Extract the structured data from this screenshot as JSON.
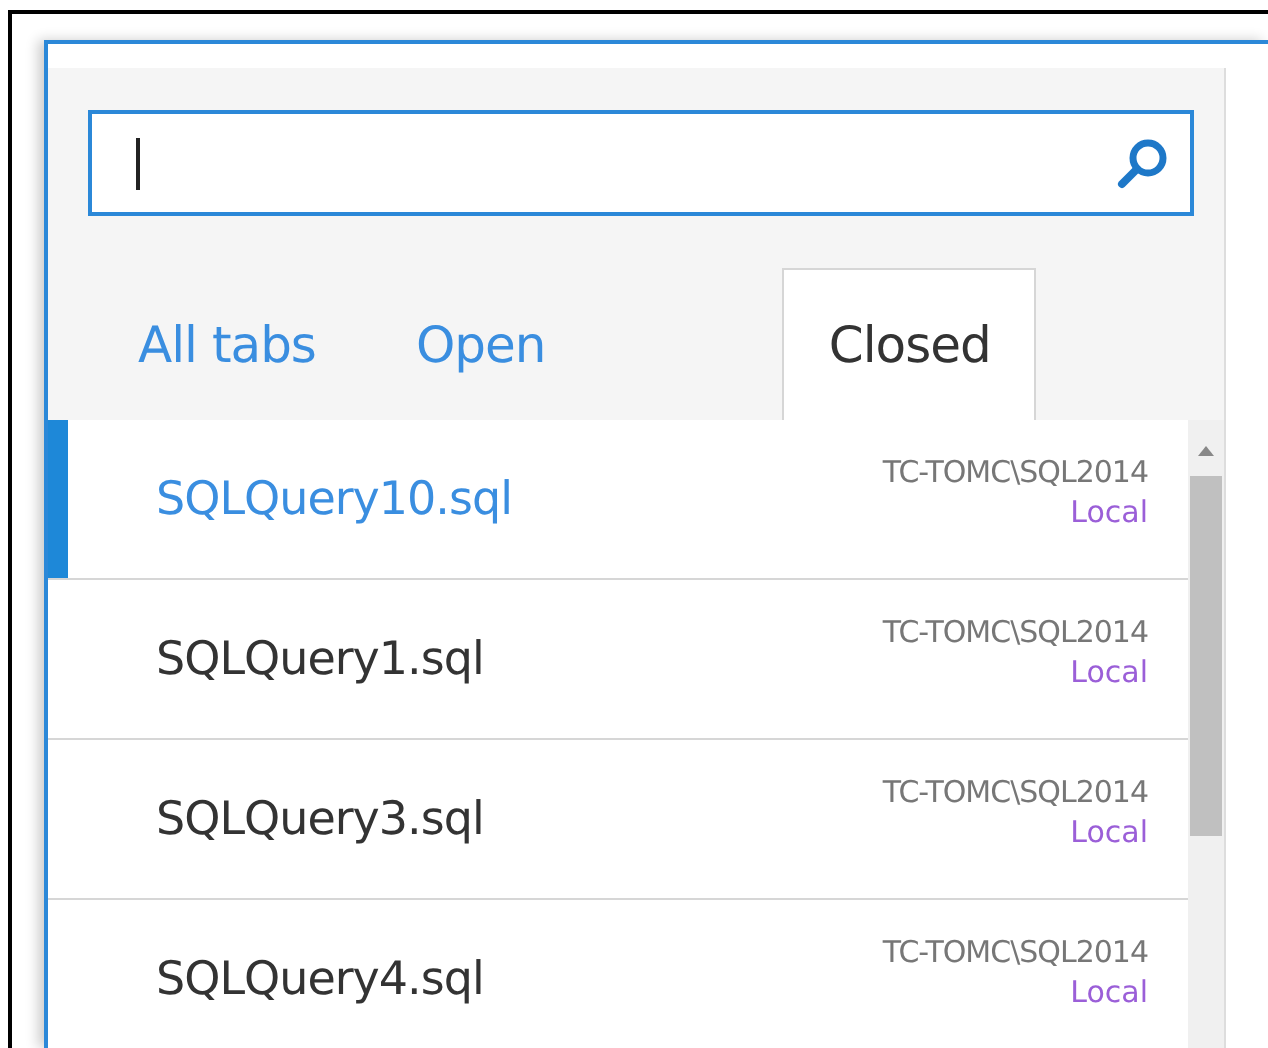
{
  "tabs": [
    {
      "label": "All tabs",
      "selected": false
    },
    {
      "label": "Open",
      "selected": false
    },
    {
      "label": "Closed",
      "selected": true
    }
  ],
  "files": [
    {
      "name": "SQLQuery10.sql",
      "server": "TC-TOMC\\SQL2014",
      "location": "Local",
      "selected": true
    },
    {
      "name": "SQLQuery1.sql",
      "server": "TC-TOMC\\SQL2014",
      "location": "Local",
      "selected": false
    },
    {
      "name": "SQLQuery3.sql",
      "server": "TC-TOMC\\SQL2014",
      "location": "Local",
      "selected": false
    },
    {
      "name": "SQLQuery4.sql",
      "server": "TC-TOMC\\SQL2014",
      "location": "Local",
      "selected": false
    }
  ]
}
